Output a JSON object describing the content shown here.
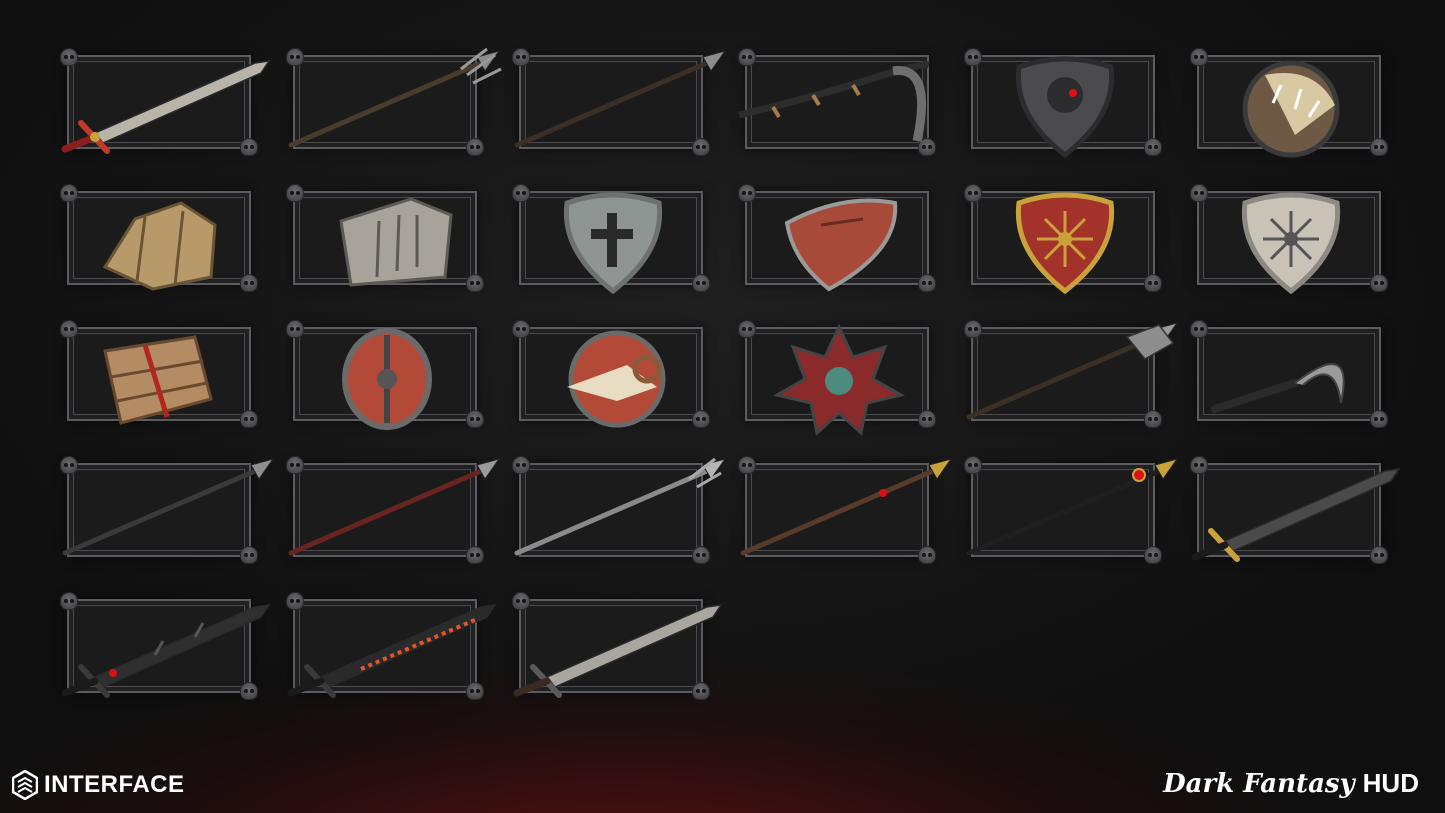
{
  "inventory": {
    "slots": [
      {
        "item": "broadsword-icon"
      },
      {
        "item": "trident-icon"
      },
      {
        "item": "spear-icon"
      },
      {
        "item": "bone-scythe-icon"
      },
      {
        "item": "skull-shield-icon"
      },
      {
        "item": "claw-shield-icon"
      },
      {
        "item": "rock-shield-icon"
      },
      {
        "item": "stone-slab-shield-icon"
      },
      {
        "item": "cross-shield-icon"
      },
      {
        "item": "red-kite-shield-icon"
      },
      {
        "item": "chaos-gold-shield-icon"
      },
      {
        "item": "chaos-silver-shield-icon"
      },
      {
        "item": "plank-shield-icon"
      },
      {
        "item": "round-red-shield-icon"
      },
      {
        "item": "ram-skull-shield-icon"
      },
      {
        "item": "spiked-flower-shield-icon"
      },
      {
        "item": "axe-staff-icon"
      },
      {
        "item": "sickle-icon"
      },
      {
        "item": "thin-spear-icon"
      },
      {
        "item": "red-spear-icon"
      },
      {
        "item": "silver-trident-spear-icon"
      },
      {
        "item": "gold-spear-icon"
      },
      {
        "item": "dark-staff-icon"
      },
      {
        "item": "dark-blade-icon"
      },
      {
        "item": "spiked-sword-icon"
      },
      {
        "item": "rune-greatsword-icon"
      },
      {
        "item": "steel-sword-icon"
      }
    ]
  },
  "branding": {
    "left_label": "INTERFACE",
    "right_title": "Dark Fantasy",
    "right_suffix": "HUD"
  },
  "colors": {
    "slot_border": "#5c5c60",
    "accent_red": "#b3261e",
    "gold": "#c9a23a"
  }
}
